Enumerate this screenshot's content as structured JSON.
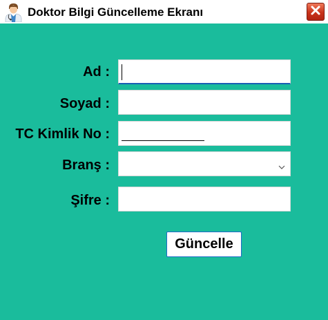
{
  "window": {
    "title": "Doktor Bilgi Güncelleme Ekranı",
    "app_icon": "doctor-icon",
    "close_icon": "close-icon"
  },
  "form": {
    "ad_label": "Ad :",
    "ad_value": "",
    "soyad_label": "Soyad :",
    "soyad_value": "",
    "tc_label": "TC Kimlik No :",
    "tc_value": "",
    "brans_label": "Branş :",
    "brans_selected": "",
    "sifre_label": "Şifre :",
    "sifre_value": ""
  },
  "actions": {
    "update_label": "Güncelle"
  },
  "colors": {
    "background": "#1abc9c",
    "titlebar": "#ffffff",
    "focus_accent": "#1a5fb4",
    "close_button": "#c8321a"
  }
}
